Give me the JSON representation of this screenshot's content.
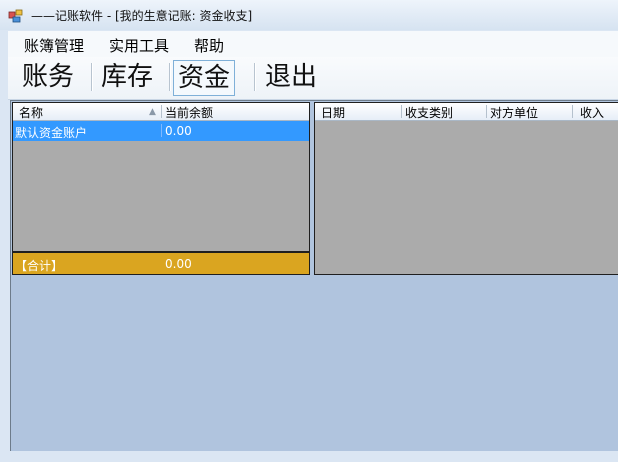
{
  "window": {
    "title": "——记账软件 - [我的生意记账: 资金收支]"
  },
  "menu": {
    "items": [
      "账簿管理",
      "实用工具",
      "帮助"
    ]
  },
  "toolbar": {
    "buttons": [
      "账务",
      "库存",
      "资金",
      "退出"
    ],
    "active": "资金"
  },
  "accounts_grid": {
    "columns": [
      "名称",
      "当前余额"
    ],
    "rows": [
      {
        "name": "默认资金账户",
        "balance": "0.00"
      }
    ],
    "total": {
      "label": "【合计】",
      "balance": "0.00"
    }
  },
  "transactions_grid": {
    "columns": [
      "日期",
      "收支类别",
      "对方单位",
      "收入"
    ]
  },
  "colors": {
    "selection": "#3399ff",
    "total_row": "#daa520",
    "client_bg": "#b0c4de",
    "grid_bg": "#ababab"
  }
}
